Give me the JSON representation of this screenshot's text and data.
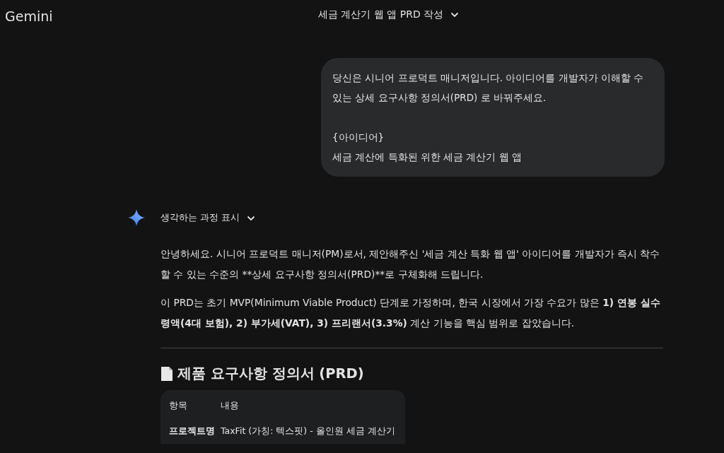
{
  "header": {
    "brand": "Gemini",
    "chat_title": "세금 계산기 웹 앱 PRD 작성"
  },
  "user_message": {
    "blocks": [
      {
        "lines": [
          "당신은 시니어 프로덕트 매니저입니다. 아이디어를 개발자가 이해할 수 있는 상세 요구사항 정의서(PRD) 로 바꿔주세요."
        ]
      },
      {
        "lines": [
          "{아이디어}",
          "세금 계산에 특화된 위한 세금 계산기 웹 앱"
        ]
      }
    ]
  },
  "response": {
    "thinking_toggle": {
      "label": "생각하는 과정 표시",
      "expanded": false
    },
    "paragraphs": [
      {
        "kind": "plain",
        "text": "안녕하세요. 시니어 프로덕트 매니저(PM)로서, 제안해주신 '세금 계산 특화 웹 앱' 아이디어를 개발자가 즉시 착수할 수 있는 수준의 **상세 요구사항 정의서(PRD)**로 구체화해 드립니다."
      },
      {
        "kind": "rich",
        "text": "이 PRD는 초기 MVP(Minimum Viable Product) 단계로 가정하며, 한국 시장에서 가장 수요가 많은 **1) 연봉 실수령액(4대 보험), 2) 부가세(VAT), 3) 프리랜서(3.3%)** 계산 기능을 핵심 범위로 잡았습니다."
      }
    ],
    "heading": "제품 요구사항 정의서 (PRD)",
    "table": {
      "columns": [
        "항목",
        "내용"
      ],
      "rows": [
        [
          "프로젝트명",
          "TaxFit (가칭: 텍스핏) - 올인원 세금 계산기"
        ]
      ]
    }
  }
}
